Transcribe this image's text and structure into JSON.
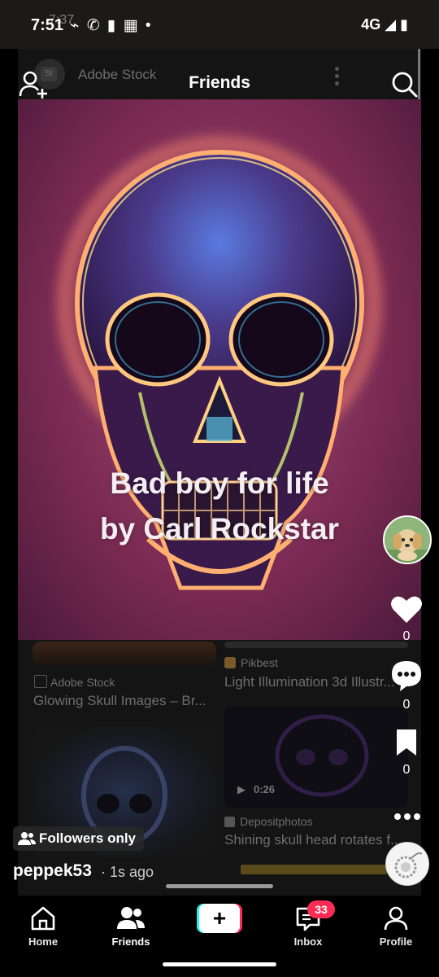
{
  "status_bar": {
    "time": "7:51",
    "ghost_time": "7:37",
    "left_icons": "⌁ ✆ ▮ ▦ •",
    "right_text": "4G ◢ ▮",
    "ghost_right": "4G"
  },
  "background_page": {
    "source_name": "Adobe Stock",
    "card1_source": "Adobe Stock",
    "card1_title": "Glowing Skull Images – Br...",
    "card2_source": "Pikbest",
    "card2_title": "Light Illumination 3d Illustr...",
    "card3_duration": "0:26",
    "card3_source": "Depositphotos",
    "card3_title": "Shining skull head rotates f..."
  },
  "header": {
    "title": "Friends",
    "add_friend_icon": "add-user-icon",
    "search_icon": "search-icon"
  },
  "post": {
    "caption_line1": "Bad boy for life",
    "caption_line2": "by Carl Rockstar",
    "username": "peppek53",
    "time_ago": "· 1s ago",
    "visibility": "Followers only",
    "likes": "0",
    "comments": "0",
    "saves": "0"
  },
  "nav": {
    "home": "Home",
    "friends": "Friends",
    "create": "+",
    "inbox": "Inbox",
    "inbox_badge": "33",
    "profile": "Profile"
  },
  "colors": {
    "accent_red": "#fe2c55",
    "accent_cyan": "#25f4ee",
    "background": "#000000"
  }
}
